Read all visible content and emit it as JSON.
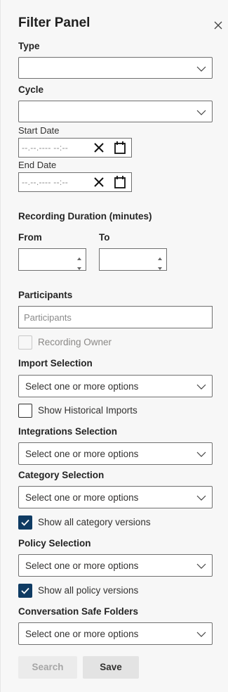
{
  "panel": {
    "title": "Filter Panel"
  },
  "type": {
    "label": "Type",
    "value": ""
  },
  "cycle": {
    "label": "Cycle",
    "value": ""
  },
  "start_date": {
    "label": "Start Date",
    "placeholder": "--.--.---- --:--"
  },
  "end_date": {
    "label": "End Date",
    "placeholder": "--.--.---- --:--"
  },
  "duration": {
    "label": "Recording Duration (minutes)",
    "from_label": "From",
    "to_label": "To"
  },
  "participants": {
    "label": "Participants",
    "placeholder": "Participants",
    "owner_label": "Recording Owner"
  },
  "import": {
    "label": "Import Selection",
    "placeholder": "Select one or more options",
    "historical_label": "Show Historical Imports"
  },
  "integrations": {
    "label": "Integrations Selection",
    "placeholder": "Select one or more options"
  },
  "category": {
    "label": "Category Selection",
    "placeholder": "Select one or more options",
    "all_versions_label": "Show all category versions"
  },
  "policy": {
    "label": "Policy Selection",
    "placeholder": "Select one or more options",
    "all_versions_label": "Show all policy versions"
  },
  "safe_folders": {
    "label": "Conversation Safe Folders",
    "placeholder": "Select one or more options"
  },
  "actions": {
    "search_label": "Search",
    "save_label": "Save"
  },
  "colors": {
    "accent": "#0f3b63",
    "border": "#707070",
    "background": "#f7f7f7"
  }
}
